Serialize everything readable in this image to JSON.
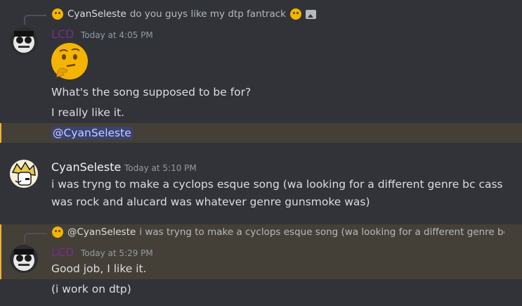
{
  "messages": [
    {
      "reply": {
        "author": "CyanSeleste",
        "text": "do you guys like my dtp fantrack"
      },
      "author": "LCD",
      "author_color": "#7c2a8c",
      "timestamp": "Today at 4:05 PM",
      "lines": [
        "What's the song supposed to be for?",
        "I really like it."
      ],
      "mention": "@CyanSeleste"
    },
    {
      "author": "CyanSeleste",
      "author_color": "#f2f3f5",
      "timestamp": "Today at 5:10 PM",
      "lines": [
        "i was tryng to make a cyclops esque song (wa looking for a different genre bc cass",
        "was rock and alucard was whatever genre gunsmoke was)"
      ]
    },
    {
      "reply": {
        "author": "@CyanSeleste",
        "text": "i was tryng to make a cyclops esque song (wa looking for a different genre bc ca"
      },
      "author": "LCD",
      "author_color": "#7c2a8c",
      "timestamp": "Today at 5:29 PM",
      "lines": [
        "Good job, I like it.",
        "(i work on dtp)"
      ]
    }
  ],
  "icons": {
    "reply_emoji": "face-emoji-icon",
    "image_attachment": "image-icon",
    "thinking_emoji": "thinking-face-emoji"
  },
  "colors": {
    "background": "#313338",
    "mention_highlight": "#444037",
    "mention_bar": "#f0b232"
  }
}
